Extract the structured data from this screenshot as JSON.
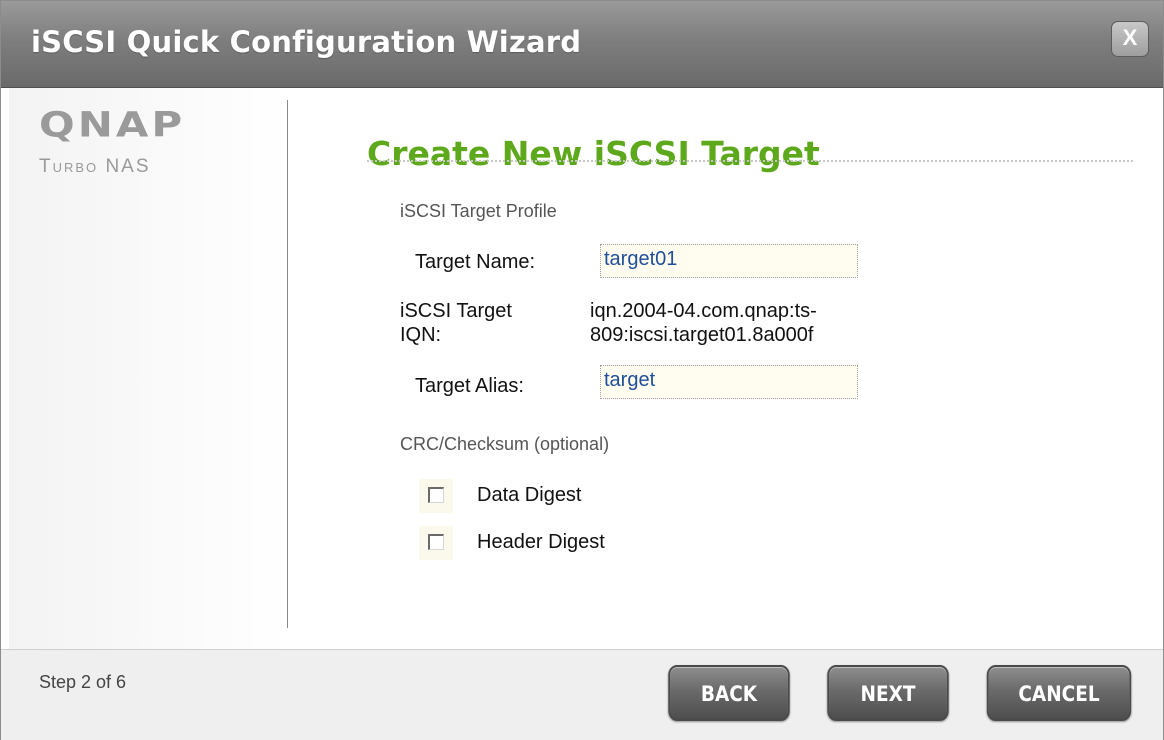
{
  "window": {
    "title": "iSCSI Quick Configuration Wizard",
    "close_glyph": "X"
  },
  "branding": {
    "logo": "QNAP",
    "tagline": "Turbo NAS"
  },
  "page": {
    "heading": "Create New iSCSI Target"
  },
  "profile": {
    "section_label": "iSCSI Target Profile",
    "target_name_label": "Target Name:",
    "target_name_value": "target01",
    "iqn_label_line1": "iSCSI Target",
    "iqn_label_line2": "IQN:",
    "iqn_value_line1": "iqn.2004-04.com.qnap:ts-",
    "iqn_value_line2": "809:iscsi.target01.8a000f",
    "alias_label": "Target Alias:",
    "alias_value": "target"
  },
  "crc": {
    "section_label": "CRC/Checksum (optional)",
    "data_digest_label": "Data Digest",
    "data_digest_checked": false,
    "header_digest_label": "Header Digest",
    "header_digest_checked": false
  },
  "footer": {
    "step_text": "Step 2 of 6",
    "back_label": "BACK",
    "next_label": "NEXT",
    "cancel_label": "CANCEL"
  },
  "colors": {
    "heading_green": "#5ea81c",
    "input_text_blue": "#1f4f9a",
    "titlebar_gray": "#7e7e7e"
  },
  "icons": {
    "close": "close-icon",
    "checkbox": "checkbox-icon"
  }
}
